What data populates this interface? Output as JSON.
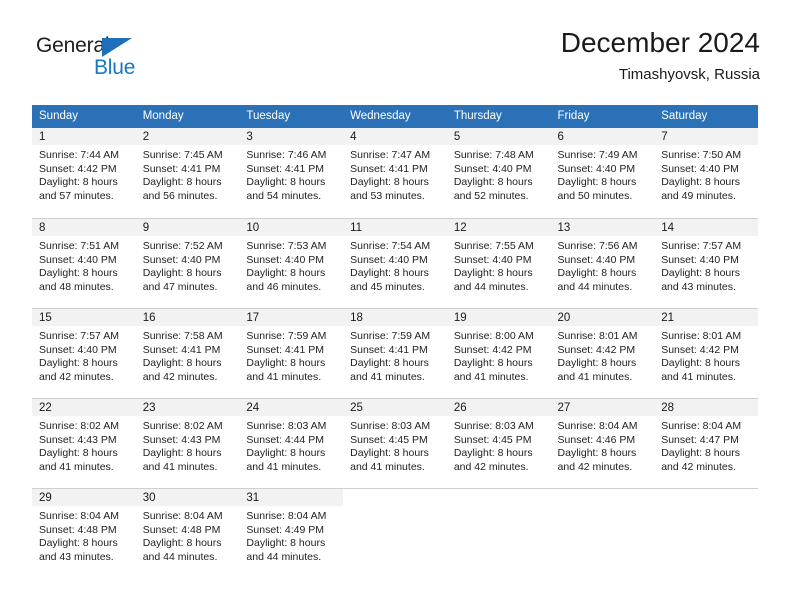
{
  "brand": {
    "name_part1": "General",
    "name_part2": "Blue",
    "accent_color": "#1878c6",
    "triangle_color": "#1e6fba"
  },
  "header": {
    "title": "December 2024",
    "subtitle": "Timashyovsk, Russia"
  },
  "theme": {
    "header_row_bg": "#2b71b8",
    "daynum_band_bg": "#f2f2f2",
    "grid_line": "#cfcfcf"
  },
  "columns": [
    "Sunday",
    "Monday",
    "Tuesday",
    "Wednesday",
    "Thursday",
    "Friday",
    "Saturday"
  ],
  "weeks": [
    [
      {
        "day": "1",
        "sunrise": "Sunrise: 7:44 AM",
        "sunset": "Sunset: 4:42 PM",
        "daylight1": "Daylight: 8 hours",
        "daylight2": "and 57 minutes."
      },
      {
        "day": "2",
        "sunrise": "Sunrise: 7:45 AM",
        "sunset": "Sunset: 4:41 PM",
        "daylight1": "Daylight: 8 hours",
        "daylight2": "and 56 minutes."
      },
      {
        "day": "3",
        "sunrise": "Sunrise: 7:46 AM",
        "sunset": "Sunset: 4:41 PM",
        "daylight1": "Daylight: 8 hours",
        "daylight2": "and 54 minutes."
      },
      {
        "day": "4",
        "sunrise": "Sunrise: 7:47 AM",
        "sunset": "Sunset: 4:41 PM",
        "daylight1": "Daylight: 8 hours",
        "daylight2": "and 53 minutes."
      },
      {
        "day": "5",
        "sunrise": "Sunrise: 7:48 AM",
        "sunset": "Sunset: 4:40 PM",
        "daylight1": "Daylight: 8 hours",
        "daylight2": "and 52 minutes."
      },
      {
        "day": "6",
        "sunrise": "Sunrise: 7:49 AM",
        "sunset": "Sunset: 4:40 PM",
        "daylight1": "Daylight: 8 hours",
        "daylight2": "and 50 minutes."
      },
      {
        "day": "7",
        "sunrise": "Sunrise: 7:50 AM",
        "sunset": "Sunset: 4:40 PM",
        "daylight1": "Daylight: 8 hours",
        "daylight2": "and 49 minutes."
      }
    ],
    [
      {
        "day": "8",
        "sunrise": "Sunrise: 7:51 AM",
        "sunset": "Sunset: 4:40 PM",
        "daylight1": "Daylight: 8 hours",
        "daylight2": "and 48 minutes."
      },
      {
        "day": "9",
        "sunrise": "Sunrise: 7:52 AM",
        "sunset": "Sunset: 4:40 PM",
        "daylight1": "Daylight: 8 hours",
        "daylight2": "and 47 minutes."
      },
      {
        "day": "10",
        "sunrise": "Sunrise: 7:53 AM",
        "sunset": "Sunset: 4:40 PM",
        "daylight1": "Daylight: 8 hours",
        "daylight2": "and 46 minutes."
      },
      {
        "day": "11",
        "sunrise": "Sunrise: 7:54 AM",
        "sunset": "Sunset: 4:40 PM",
        "daylight1": "Daylight: 8 hours",
        "daylight2": "and 45 minutes."
      },
      {
        "day": "12",
        "sunrise": "Sunrise: 7:55 AM",
        "sunset": "Sunset: 4:40 PM",
        "daylight1": "Daylight: 8 hours",
        "daylight2": "and 44 minutes."
      },
      {
        "day": "13",
        "sunrise": "Sunrise: 7:56 AM",
        "sunset": "Sunset: 4:40 PM",
        "daylight1": "Daylight: 8 hours",
        "daylight2": "and 44 minutes."
      },
      {
        "day": "14",
        "sunrise": "Sunrise: 7:57 AM",
        "sunset": "Sunset: 4:40 PM",
        "daylight1": "Daylight: 8 hours",
        "daylight2": "and 43 minutes."
      }
    ],
    [
      {
        "day": "15",
        "sunrise": "Sunrise: 7:57 AM",
        "sunset": "Sunset: 4:40 PM",
        "daylight1": "Daylight: 8 hours",
        "daylight2": "and 42 minutes."
      },
      {
        "day": "16",
        "sunrise": "Sunrise: 7:58 AM",
        "sunset": "Sunset: 4:41 PM",
        "daylight1": "Daylight: 8 hours",
        "daylight2": "and 42 minutes."
      },
      {
        "day": "17",
        "sunrise": "Sunrise: 7:59 AM",
        "sunset": "Sunset: 4:41 PM",
        "daylight1": "Daylight: 8 hours",
        "daylight2": "and 41 minutes."
      },
      {
        "day": "18",
        "sunrise": "Sunrise: 7:59 AM",
        "sunset": "Sunset: 4:41 PM",
        "daylight1": "Daylight: 8 hours",
        "daylight2": "and 41 minutes."
      },
      {
        "day": "19",
        "sunrise": "Sunrise: 8:00 AM",
        "sunset": "Sunset: 4:42 PM",
        "daylight1": "Daylight: 8 hours",
        "daylight2": "and 41 minutes."
      },
      {
        "day": "20",
        "sunrise": "Sunrise: 8:01 AM",
        "sunset": "Sunset: 4:42 PM",
        "daylight1": "Daylight: 8 hours",
        "daylight2": "and 41 minutes."
      },
      {
        "day": "21",
        "sunrise": "Sunrise: 8:01 AM",
        "sunset": "Sunset: 4:42 PM",
        "daylight1": "Daylight: 8 hours",
        "daylight2": "and 41 minutes."
      }
    ],
    [
      {
        "day": "22",
        "sunrise": "Sunrise: 8:02 AM",
        "sunset": "Sunset: 4:43 PM",
        "daylight1": "Daylight: 8 hours",
        "daylight2": "and 41 minutes."
      },
      {
        "day": "23",
        "sunrise": "Sunrise: 8:02 AM",
        "sunset": "Sunset: 4:43 PM",
        "daylight1": "Daylight: 8 hours",
        "daylight2": "and 41 minutes."
      },
      {
        "day": "24",
        "sunrise": "Sunrise: 8:03 AM",
        "sunset": "Sunset: 4:44 PM",
        "daylight1": "Daylight: 8 hours",
        "daylight2": "and 41 minutes."
      },
      {
        "day": "25",
        "sunrise": "Sunrise: 8:03 AM",
        "sunset": "Sunset: 4:45 PM",
        "daylight1": "Daylight: 8 hours",
        "daylight2": "and 41 minutes."
      },
      {
        "day": "26",
        "sunrise": "Sunrise: 8:03 AM",
        "sunset": "Sunset: 4:45 PM",
        "daylight1": "Daylight: 8 hours",
        "daylight2": "and 42 minutes."
      },
      {
        "day": "27",
        "sunrise": "Sunrise: 8:04 AM",
        "sunset": "Sunset: 4:46 PM",
        "daylight1": "Daylight: 8 hours",
        "daylight2": "and 42 minutes."
      },
      {
        "day": "28",
        "sunrise": "Sunrise: 8:04 AM",
        "sunset": "Sunset: 4:47 PM",
        "daylight1": "Daylight: 8 hours",
        "daylight2": "and 42 minutes."
      }
    ],
    [
      {
        "day": "29",
        "sunrise": "Sunrise: 8:04 AM",
        "sunset": "Sunset: 4:48 PM",
        "daylight1": "Daylight: 8 hours",
        "daylight2": "and 43 minutes."
      },
      {
        "day": "30",
        "sunrise": "Sunrise: 8:04 AM",
        "sunset": "Sunset: 4:48 PM",
        "daylight1": "Daylight: 8 hours",
        "daylight2": "and 44 minutes."
      },
      {
        "day": "31",
        "sunrise": "Sunrise: 8:04 AM",
        "sunset": "Sunset: 4:49 PM",
        "daylight1": "Daylight: 8 hours",
        "daylight2": "and 44 minutes."
      },
      {
        "day": "",
        "sunrise": "",
        "sunset": "",
        "daylight1": "",
        "daylight2": ""
      },
      {
        "day": "",
        "sunrise": "",
        "sunset": "",
        "daylight1": "",
        "daylight2": ""
      },
      {
        "day": "",
        "sunrise": "",
        "sunset": "",
        "daylight1": "",
        "daylight2": ""
      },
      {
        "day": "",
        "sunrise": "",
        "sunset": "",
        "daylight1": "",
        "daylight2": ""
      }
    ]
  ]
}
